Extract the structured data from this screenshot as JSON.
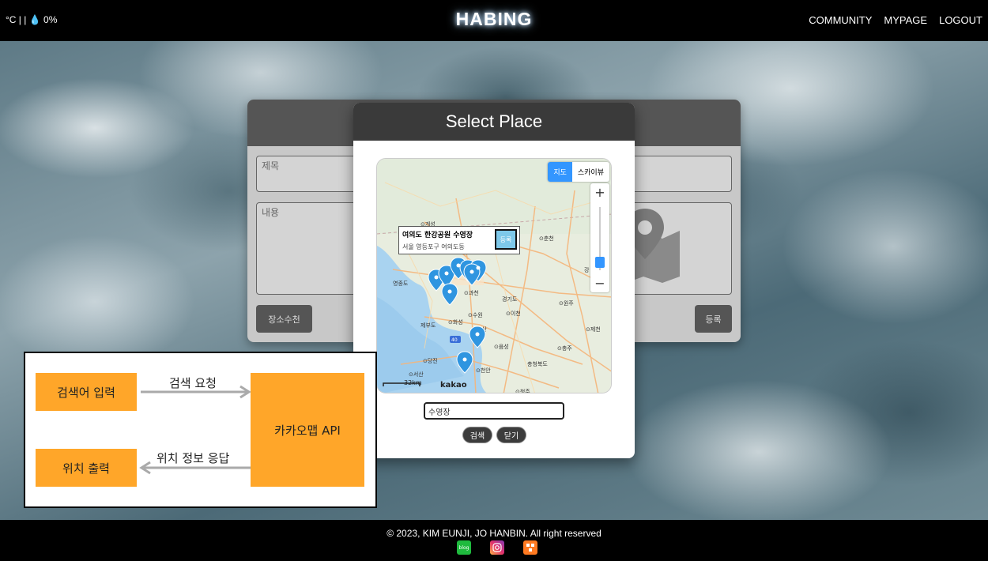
{
  "header": {
    "weather_temp": "°C | |",
    "weather_humidity": "0%",
    "logo": "HABING",
    "nav": [
      "COMMUNITY",
      "MYPAGE",
      "LOGOUT"
    ]
  },
  "form": {
    "title_placeholder": "제목",
    "content_placeholder": "내용",
    "recommend_button": "장소수천",
    "register_button": "등록"
  },
  "modal": {
    "title": "Select Place",
    "search_value": "수영장",
    "search_button": "검색",
    "close_button": "닫기",
    "map": {
      "type_map": "지도",
      "type_skyview": "스카이뷰",
      "zoom_in": "+",
      "zoom_out": "−",
      "info_title": "여의도 한강공원 수영장",
      "info_address": "서울 영등포구 여의도동",
      "info_register": "등록",
      "scale": "32km",
      "brand": "kakao",
      "place_labels": [
        "개성",
        "춘천",
        "과천",
        "경기도",
        "원주",
        "수원",
        "이천",
        "화성",
        "제천",
        "아산",
        "음성",
        "충주",
        "당진",
        "충청북도",
        "서산",
        "천안",
        "강릉",
        "청주",
        "영종도",
        "제부도"
      ]
    }
  },
  "diagram": {
    "input_box": "검색어 입력",
    "output_box": "위치 출력",
    "api_box": "카카오맵 API",
    "request_label": "검색 요청",
    "response_label": "위치 정보 응답"
  },
  "footer": {
    "copyright": "© 2023, KIM EUNJI, JO HANBIN. All right reserved",
    "icons": [
      "blog-icon",
      "instagram-icon",
      "app-icon"
    ],
    "blog_text": "blog"
  }
}
